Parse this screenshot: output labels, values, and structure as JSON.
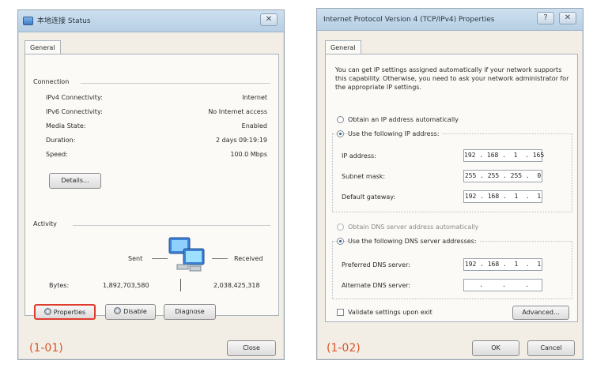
{
  "left_window": {
    "title": "本地连接 Status",
    "close_icon": "close-icon",
    "tab": "General",
    "connection": {
      "heading": "Connection",
      "rows": [
        {
          "label": "IPv4 Connectivity:",
          "value": "Internet"
        },
        {
          "label": "IPv6 Connectivity:",
          "value": "No Internet access"
        },
        {
          "label": "Media State:",
          "value": "Enabled"
        },
        {
          "label": "Duration:",
          "value": "2 days 09:19:19"
        },
        {
          "label": "Speed:",
          "value": "100.0 Mbps"
        }
      ],
      "details_button": "Details..."
    },
    "activity": {
      "heading": "Activity",
      "sent_label": "Sent",
      "received_label": "Received",
      "bytes_label": "Bytes:",
      "bytes_sent": "1,892,703,580",
      "bytes_received": "2,038,425,318",
      "icon": "network-computers-icon"
    },
    "buttons": {
      "properties": "Properties",
      "disable": "Disable",
      "diagnose": "Diagnose",
      "close": "Close"
    },
    "caption": "(1-01)"
  },
  "right_window": {
    "title": "Internet Protocol Version 4 (TCP/IPv4) Properties",
    "help_icon": "help-icon",
    "close_icon": "close-icon",
    "tab": "General",
    "description": "You can get IP settings assigned automatically if your network supports this capability. Otherwise, you need to ask your network administrator for the appropriate IP settings.",
    "ip_options": {
      "auto_label": "Obtain an IP address automatically",
      "manual_label": "Use the following IP address:",
      "selected": "manual"
    },
    "ip_fields": [
      {
        "label": "IP address:",
        "value": "192 . 168 .  1  . 165"
      },
      {
        "label": "Subnet mask:",
        "value": "255 . 255 . 255 .  0"
      },
      {
        "label": "Default gateway:",
        "value": "192 . 168 .  1  .  1"
      }
    ],
    "dns_options": {
      "auto_label": "Obtain DNS server address automatically",
      "manual_label": "Use the following DNS server addresses:",
      "selected": "manual"
    },
    "dns_fields": [
      {
        "label": "Preferred DNS server:",
        "value": "192 . 168 .  1  .  1"
      },
      {
        "label": "Alternate DNS server:",
        "value": "    .     .     .    "
      }
    ],
    "validate_label": "Validate settings upon exit",
    "validate_checked": false,
    "buttons": {
      "advanced": "Advanced...",
      "ok": "OK",
      "cancel": "Cancel"
    },
    "caption": "(1-02)"
  },
  "colors": {
    "caption": "#d8552a",
    "properties_highlight": "#e03c2e"
  }
}
